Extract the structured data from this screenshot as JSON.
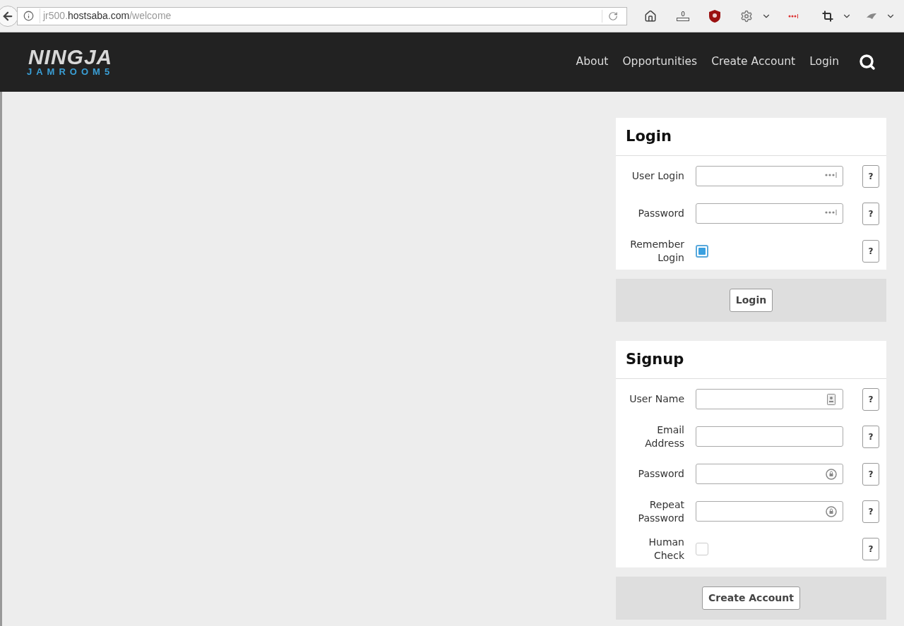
{
  "browser": {
    "url": {
      "subdomain": "jr500.",
      "domain": "hostsaba.com",
      "path": "/welcome"
    },
    "download_count": "0"
  },
  "logo": {
    "title": "NINGJA",
    "subtitle": "JAMROOM5"
  },
  "nav": {
    "items": [
      "About",
      "Opportunities",
      "Create Account",
      "Login"
    ]
  },
  "forms": [
    {
      "title": "Login",
      "fields": [
        {
          "kind": "autofill",
          "label": "User Login"
        },
        {
          "kind": "autofill",
          "label": "Password"
        },
        {
          "kind": "checkbox",
          "label": "Remember Login",
          "checked": true
        }
      ],
      "help": "?",
      "submit": "Login"
    },
    {
      "title": "Signup",
      "fields": [
        {
          "kind": "username",
          "label": "User Name"
        },
        {
          "kind": "text",
          "label": "Email Address"
        },
        {
          "kind": "password",
          "label": "Password"
        },
        {
          "kind": "password",
          "label": "Repeat Password"
        },
        {
          "kind": "checkbox",
          "label": "Human Check",
          "checked": false
        }
      ],
      "help": "?",
      "submit": "Create Account"
    }
  ]
}
